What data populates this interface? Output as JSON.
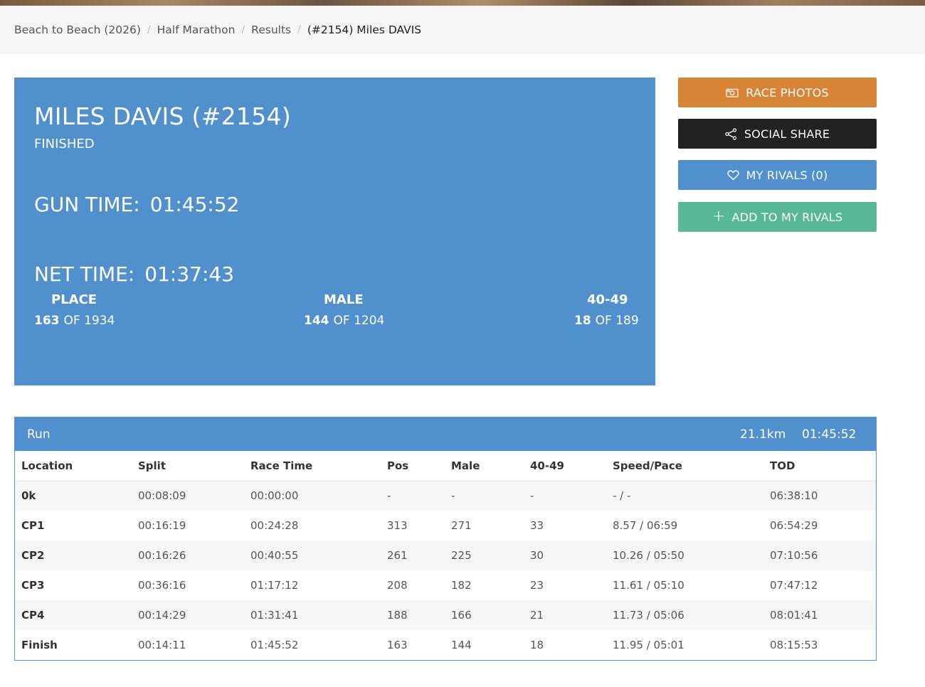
{
  "breadcrumb": [
    "Beach to Beach (2026)",
    "Half Marathon",
    "Results"
  ],
  "breadcrumb_active": "(#2154) Miles DAVIS",
  "athlete": {
    "name": "MILES DAVIS (#2154)",
    "status": "FINISHED",
    "gun_label": "GUN TIME:",
    "gun_time": "01:45:52",
    "net_label": "NET TIME:",
    "net_time": "01:37:43"
  },
  "ranks": {
    "place": {
      "label": "PLACE",
      "rank": "163",
      "of": "OF 1934"
    },
    "gender": {
      "label": "MALE",
      "rank": "144",
      "of": "OF 1204"
    },
    "age": {
      "label": "40-49",
      "rank": "18",
      "of": "OF 189"
    }
  },
  "buttons": {
    "photos": "RACE PHOTOS",
    "share": "SOCIAL SHARE",
    "rivals": "MY RIVALS (0)",
    "add": "ADD TO MY RIVALS"
  },
  "icons": {
    "photos": "camera-icon",
    "share": "share-icon",
    "rivals": "heart-icon",
    "add": "plus-icon"
  },
  "colors": {
    "primary": "#4f90cd",
    "photos": "#d88437",
    "share": "#222222",
    "add": "#58b795"
  },
  "splits": {
    "title": "Run",
    "distance": "21.1km",
    "total_time": "01:45:52",
    "columns": [
      "Location",
      "Split",
      "Race Time",
      "Pos",
      "Male",
      "40-49",
      "Speed/Pace",
      "TOD"
    ],
    "rows": [
      [
        "0k",
        "00:08:09",
        "00:00:00",
        "-",
        "-",
        "-",
        "- / -",
        "06:38:10"
      ],
      [
        "CP1",
        "00:16:19",
        "00:24:28",
        "313",
        "271",
        "33",
        "8.57 / 06:59",
        "06:54:29"
      ],
      [
        "CP2",
        "00:16:26",
        "00:40:55",
        "261",
        "225",
        "30",
        "10.26 / 05:50",
        "07:10:56"
      ],
      [
        "CP3",
        "00:36:16",
        "01:17:12",
        "208",
        "182",
        "23",
        "11.61 / 05:10",
        "07:47:12"
      ],
      [
        "CP4",
        "00:14:29",
        "01:31:41",
        "188",
        "166",
        "21",
        "11.73 / 05:06",
        "08:01:41"
      ],
      [
        "Finish",
        "00:14:11",
        "01:45:52",
        "163",
        "144",
        "18",
        "11.95 / 05:01",
        "08:15:53"
      ]
    ]
  }
}
